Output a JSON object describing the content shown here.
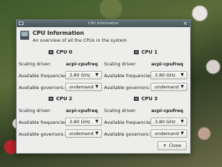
{
  "window": {
    "title": "CPU Information"
  },
  "header": {
    "title": "CPU Information",
    "subtitle": "An overview of all the CPUs in the system"
  },
  "labels": {
    "scaling_driver": "Scaling driver:",
    "available_frequencies": "Available frequencies:",
    "available_governors": "Available governors:"
  },
  "cpus": [
    {
      "title": "CPU 0",
      "driver": "acpi-cpufreq",
      "frequency": "3.80 GHz",
      "governor": "ondemand"
    },
    {
      "title": "CPU 1",
      "driver": "acpi-cpufreq",
      "frequency": "3.80 GHz",
      "governor": "ondemand"
    },
    {
      "title": "CPU 2",
      "driver": "acpi-cpufreq",
      "frequency": "3.80 GHz",
      "governor": "ondemand"
    },
    {
      "title": "CPU 3",
      "driver": "acpi-cpufreq",
      "frequency": "3.80 GHz",
      "governor": "ondemand"
    }
  ],
  "icons": {
    "close": "close-icon",
    "cpu": "cpu-chip-icon",
    "dropdown": "chevron-down-icon",
    "app": "monitor-icon"
  },
  "buttons": {
    "close_label": "Close"
  }
}
